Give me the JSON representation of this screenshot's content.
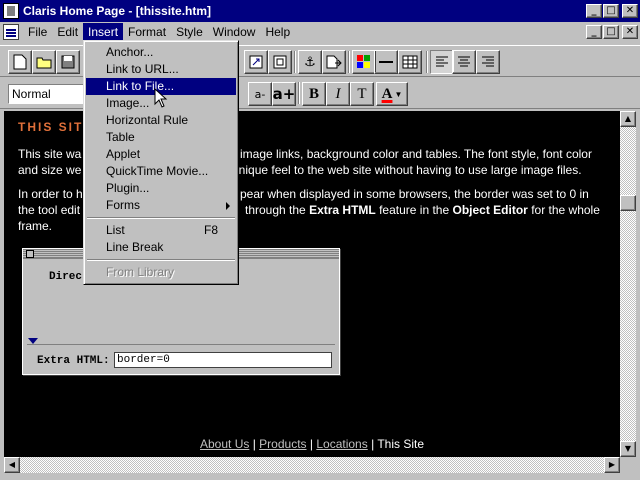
{
  "window": {
    "title": "Claris Home Page - [thissite.htm]",
    "controls": {
      "minimize": "_",
      "maximize": "□",
      "close": "✕"
    }
  },
  "menubar": {
    "items": [
      "File",
      "Edit",
      "Insert",
      "Format",
      "Style",
      "Window",
      "Help"
    ],
    "active": "Insert"
  },
  "toolbar": {
    "style_select": "Normal",
    "font_smaller": "a-",
    "font_larger": "a+",
    "bold": "B",
    "italic": "I",
    "teletype": "T",
    "color": "A"
  },
  "insert_menu": {
    "items": [
      {
        "label": "Anchor...",
        "underline": "A"
      },
      {
        "label": "Link to URL...",
        "underline": "U"
      },
      {
        "label": "Link to File...",
        "underline": "F",
        "highlighted": true
      },
      {
        "label": "Image...",
        "underline": "I"
      },
      {
        "label": "Horizontal Rule",
        "underline": "R"
      },
      {
        "label": "Table",
        "underline": "T"
      },
      {
        "label": "Applet",
        "underline": "p"
      },
      {
        "label": "QuickTime Movie...",
        "underline": "Q"
      },
      {
        "label": "Plugin...",
        "underline": "g"
      },
      {
        "label": "Forms",
        "underline": "o",
        "submenu": true
      },
      {
        "label": "List",
        "underline": "L",
        "shortcut": "F8"
      },
      {
        "label": "Line Break",
        "underline": "B"
      },
      {
        "label": "From Library",
        "disabled": true
      }
    ]
  },
  "document": {
    "heading": "THIS SIT",
    "para1_lines": [
      "This site wa",
      "image links, background color and tables. The font style, font color",
      "and size we",
      "unique feel to the web site without having to use large image files."
    ],
    "para2_lines": [
      "In order to h",
      "pear when displayed in some browsers, the border was set to 0 in",
      "the tool edit",
      "through the",
      "Extra HTML",
      "feature in the",
      "Object Editor",
      "for the whole",
      "frame."
    ],
    "footer": {
      "links": [
        "About Us",
        "Products",
        "Locations"
      ],
      "current": "This Site",
      "separator": "|"
    }
  },
  "object_editor": {
    "label_partial": "Direc",
    "extra_html_label": "Extra HTML:",
    "extra_html_value": "border=0"
  },
  "colors": {
    "titlebar": "#000080",
    "heading": "#e0703a",
    "doc_background": "#000000",
    "link": "#c0c0c0"
  }
}
